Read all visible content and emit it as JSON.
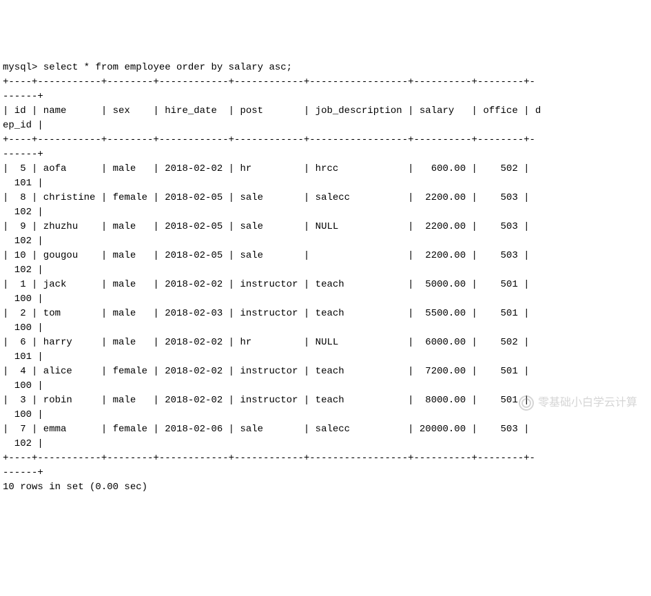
{
  "prompt": "mysql>",
  "query": "select * from employee order by salary asc;",
  "columns": [
    "id",
    "name",
    "sex",
    "hire_date",
    "post",
    "job_description",
    "salary",
    "office",
    "dep_id"
  ],
  "rows": [
    {
      "id": "5",
      "name": "aofa",
      "sex": "male",
      "hire_date": "2018-02-02",
      "post": "hr",
      "job_description": "hrcc",
      "salary": "600.00",
      "office": "502",
      "dep_id": "101"
    },
    {
      "id": "8",
      "name": "christine",
      "sex": "female",
      "hire_date": "2018-02-05",
      "post": "sale",
      "job_description": "salecc",
      "salary": "2200.00",
      "office": "503",
      "dep_id": "102"
    },
    {
      "id": "9",
      "name": "zhuzhu",
      "sex": "male",
      "hire_date": "2018-02-05",
      "post": "sale",
      "job_description": "NULL",
      "salary": "2200.00",
      "office": "503",
      "dep_id": "102"
    },
    {
      "id": "10",
      "name": "gougou",
      "sex": "male",
      "hire_date": "2018-02-05",
      "post": "sale",
      "job_description": "",
      "salary": "2200.00",
      "office": "503",
      "dep_id": "102"
    },
    {
      "id": "1",
      "name": "jack",
      "sex": "male",
      "hire_date": "2018-02-02",
      "post": "instructor",
      "job_description": "teach",
      "salary": "5000.00",
      "office": "501",
      "dep_id": "100"
    },
    {
      "id": "2",
      "name": "tom",
      "sex": "male",
      "hire_date": "2018-02-03",
      "post": "instructor",
      "job_description": "teach",
      "salary": "5500.00",
      "office": "501",
      "dep_id": "100"
    },
    {
      "id": "6",
      "name": "harry",
      "sex": "male",
      "hire_date": "2018-02-02",
      "post": "hr",
      "job_description": "NULL",
      "salary": "6000.00",
      "office": "502",
      "dep_id": "101"
    },
    {
      "id": "4",
      "name": "alice",
      "sex": "female",
      "hire_date": "2018-02-02",
      "post": "instructor",
      "job_description": "teach",
      "salary": "7200.00",
      "office": "501",
      "dep_id": "100"
    },
    {
      "id": "3",
      "name": "robin",
      "sex": "male",
      "hire_date": "2018-02-02",
      "post": "instructor",
      "job_description": "teach",
      "salary": "8000.00",
      "office": "501",
      "dep_id": "100"
    },
    {
      "id": "7",
      "name": "emma",
      "sex": "female",
      "hire_date": "2018-02-06",
      "post": "sale",
      "job_description": "salecc",
      "salary": "20000.00",
      "office": "503",
      "dep_id": "102"
    }
  ],
  "footer": "10 rows in set (0.00 sec)",
  "watermark": "零基础小白学云计算",
  "separator_line1": "+----+-----------+--------+------------+------------+-----------------+----------+--------+-",
  "separator_line2": "------+",
  "header_line1": "| id | name      | sex    | hire_date  | post       | job_description | salary   | office | d",
  "header_line2": "ep_id |"
}
